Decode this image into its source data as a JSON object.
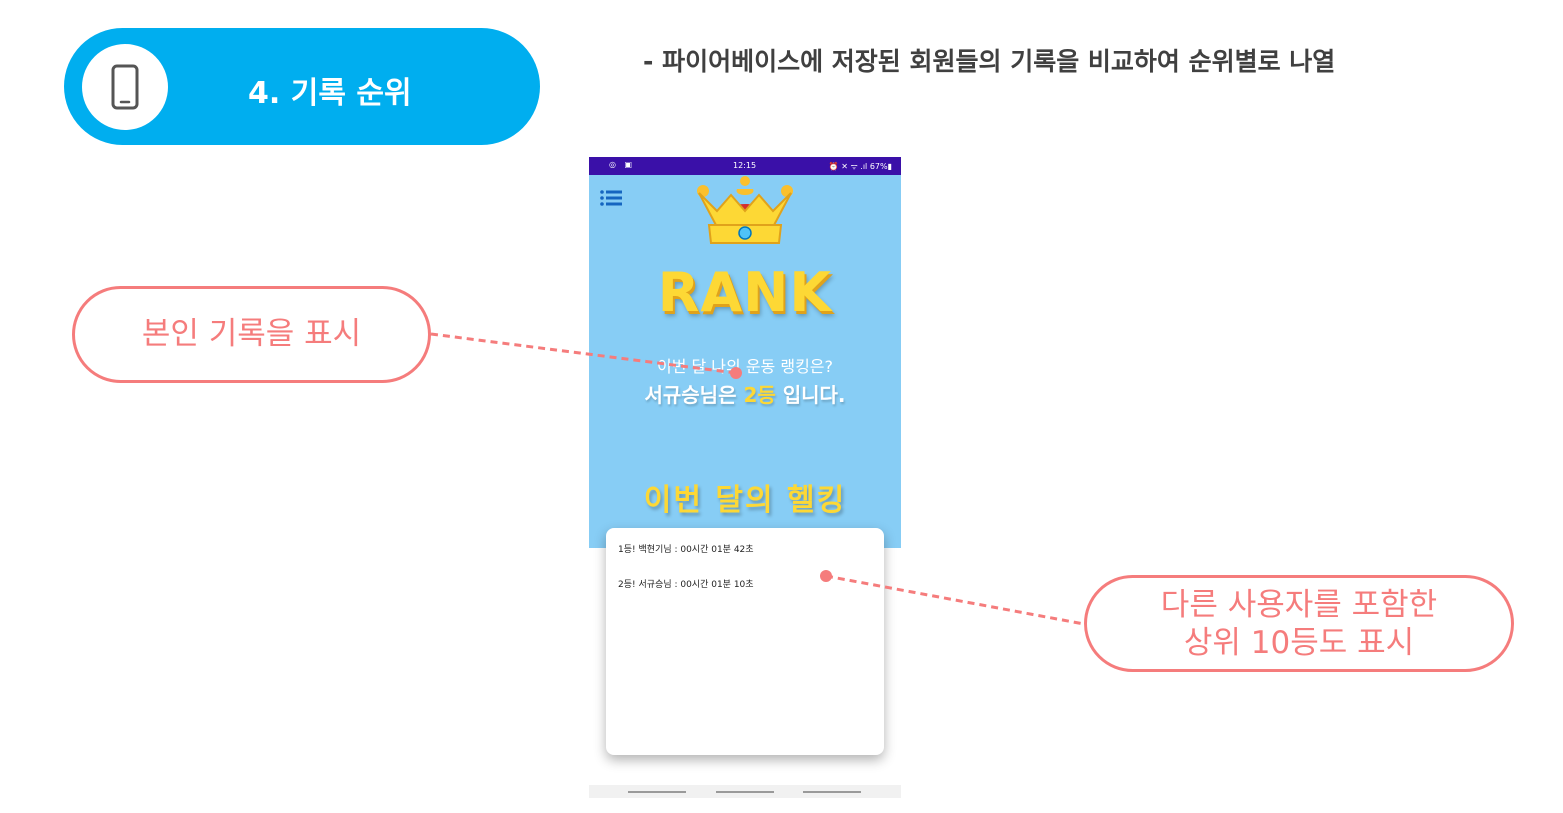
{
  "header": {
    "section_title": "4. 기록 순위",
    "icon": "smartphone-icon",
    "accent_color": "#00aeef",
    "description": "- 파이어베이스에 저장된 회원들의 기록을 비교하여 순위별로 나열"
  },
  "phone": {
    "statusbar": {
      "left_icons": "◎ ▣",
      "time": "12:15",
      "right_status": "⏰ ✕ ᯤ .ıl 67%▮"
    },
    "menu_icon": "list-menu-icon",
    "crown_icon": "crown-icon",
    "rank_title": "RANK",
    "question": "이번 달 나의 운동 랭킹은?",
    "result_prefix": "서규승님은 ",
    "result_rank": "2등",
    "result_suffix": " 입니다.",
    "month_title": "이번 달의 헬킹",
    "ranking_list": [
      "1등! 백현기님 : 00시간 01분 42초",
      "2등! 서규승님 : 00시간 01분 10초"
    ],
    "screen_color": "#87cdf5",
    "highlight_color": "#fdd835"
  },
  "callouts": {
    "self_record": "본인 기록을 표시",
    "others_line1": "다른 사용자를 포함한",
    "others_line2": "상위 10등도 표시",
    "color": "#f57c7c"
  }
}
